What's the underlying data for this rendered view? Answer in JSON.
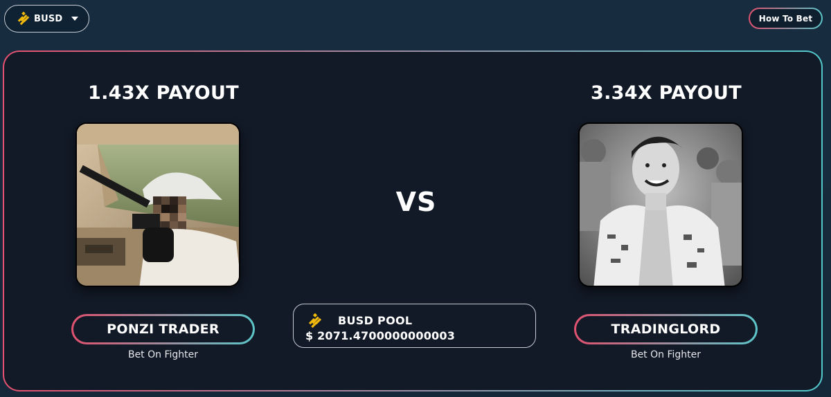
{
  "header": {
    "token_selector": {
      "label": "BUSD",
      "icon": "busd-logo-icon"
    },
    "how_to_bet_label": "How To Bet"
  },
  "colors": {
    "gradient_start": "#e0516f",
    "gradient_end": "#5cc6c9",
    "panel_bg": "#121a27",
    "page_bg": "#16293b",
    "busd_yellow": "#f0b90b"
  },
  "match": {
    "left": {
      "payout": "1.43X PAYOUT",
      "name": "PONZI TRADER",
      "bet_label": "Bet On Fighter"
    },
    "vs_label": "VS",
    "right": {
      "payout": "3.34X PAYOUT",
      "name": "TRADINGLORD",
      "bet_label": "Bet On Fighter"
    },
    "pool": {
      "title": "BUSD POOL",
      "amount": "$ 2071.4700000000003",
      "icon": "busd-logo-icon"
    }
  }
}
